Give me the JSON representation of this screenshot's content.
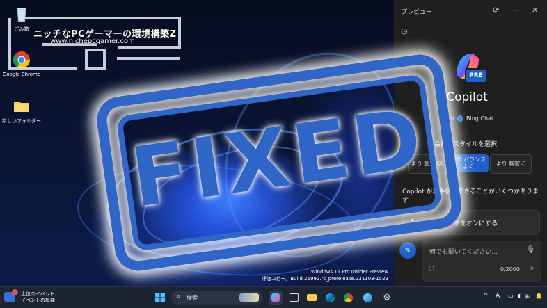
{
  "desktop": {
    "icons": [
      {
        "label": "ごみ箱"
      },
      {
        "label": "Google Chrome"
      },
      {
        "label": "新しいフォルダー"
      }
    ],
    "watermark": {
      "title": "ニッチなPCゲーマーの環境構築Z",
      "url": "www.nichepcgamer.com"
    },
    "stamp": {
      "text": "FIXED"
    },
    "build_info": {
      "line1": "Windows 11 Pro Insider Preview",
      "line2": "評価コピー。Build 25992.rs_prerelease.231103-1529"
    }
  },
  "copilot_panel": {
    "header_title": "プレビュー",
    "logo_badge": "PRE",
    "title": "Copilot",
    "with_label": "with",
    "bing_chat": "Bing Chat",
    "style_prompt": "会話のスタイルを選択",
    "styles": [
      {
        "label": "より 創造的に"
      },
      {
        "label": "より バランスよく"
      },
      {
        "label": "より 厳密に"
      }
    ],
    "help_text": "Copilot がお手伝いできることがいくつかあります",
    "suggestion": "ダークモードをオンにする",
    "input_placeholder": "何でも聞いてください...",
    "char_count": "0/2000",
    "accent_color": "#1f5fc9"
  },
  "taskbar": {
    "widget": {
      "badge": "1",
      "line1": "上位のイベント",
      "line2": "イベントの概要"
    },
    "search_label": "検索",
    "tray": {
      "chevron": "^",
      "ime": "A"
    }
  }
}
